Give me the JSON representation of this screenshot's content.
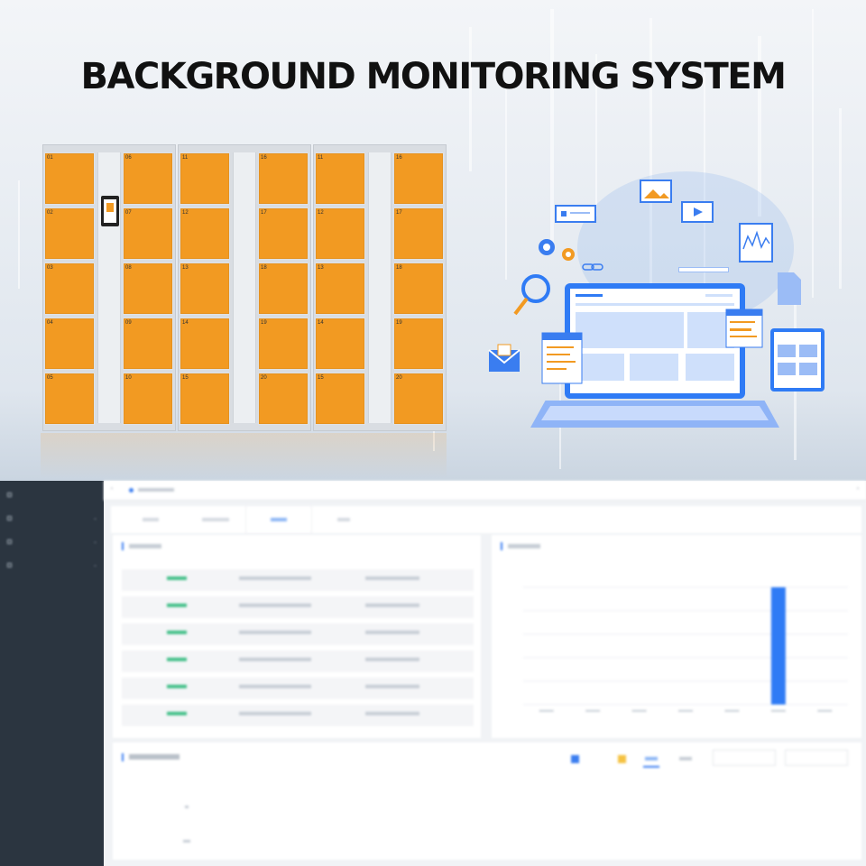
{
  "hero": {
    "title": "BACKGROUND MONITORING SYSTEM"
  },
  "lockers": {
    "cabinets": [
      {
        "left_numbers": [
          "01",
          "02",
          "03",
          "04",
          "05"
        ],
        "right_numbers": [
          "06",
          "07",
          "08",
          "09",
          "10"
        ],
        "has_screen": true
      },
      {
        "left_numbers": [
          "11",
          "12",
          "13",
          "14",
          "15"
        ],
        "right_numbers": [
          "16",
          "17",
          "18",
          "19",
          "20"
        ],
        "has_screen": false
      },
      {
        "left_numbers": [
          "11",
          "12",
          "13",
          "14",
          "15"
        ],
        "right_numbers": [
          "16",
          "17",
          "18",
          "19",
          "20"
        ],
        "has_screen": false
      }
    ],
    "door_color": "#f29a22"
  },
  "illustration": {
    "icons": [
      "gear-icon",
      "search-icon",
      "mail-icon",
      "image-icon",
      "video-icon",
      "chat-icon",
      "chart-icon",
      "document-icon",
      "tablet-icon",
      "laptop-icon"
    ],
    "accent": "#2f7bf5"
  },
  "dashboard": {
    "sidebar": {
      "items": [
        {
          "label": "",
          "has_caret": false
        },
        {
          "label": "",
          "has_caret": true
        },
        {
          "label": "",
          "has_caret": true
        },
        {
          "label": "",
          "has_caret": true
        }
      ]
    },
    "tabs": [
      {
        "label": "",
        "active": false
      },
      {
        "label": "",
        "active": false
      },
      {
        "label": "",
        "active": true
      },
      {
        "label": "",
        "active": false
      }
    ],
    "status_color": "#44c08a",
    "accent": "#3a7df0",
    "activity_rows": 6,
    "chart_color": "#2f7bf5",
    "legend": [
      {
        "color": "#3a7df0"
      },
      {
        "color": "#f5c242"
      }
    ]
  },
  "chart_data": {
    "type": "bar",
    "categories": [
      "c1",
      "c2",
      "c3",
      "c4",
      "c5",
      "c6",
      "c7"
    ],
    "values": [
      0,
      0,
      0,
      0,
      0,
      1,
      0
    ],
    "ylim": [
      0,
      1
    ],
    "grid": true
  }
}
